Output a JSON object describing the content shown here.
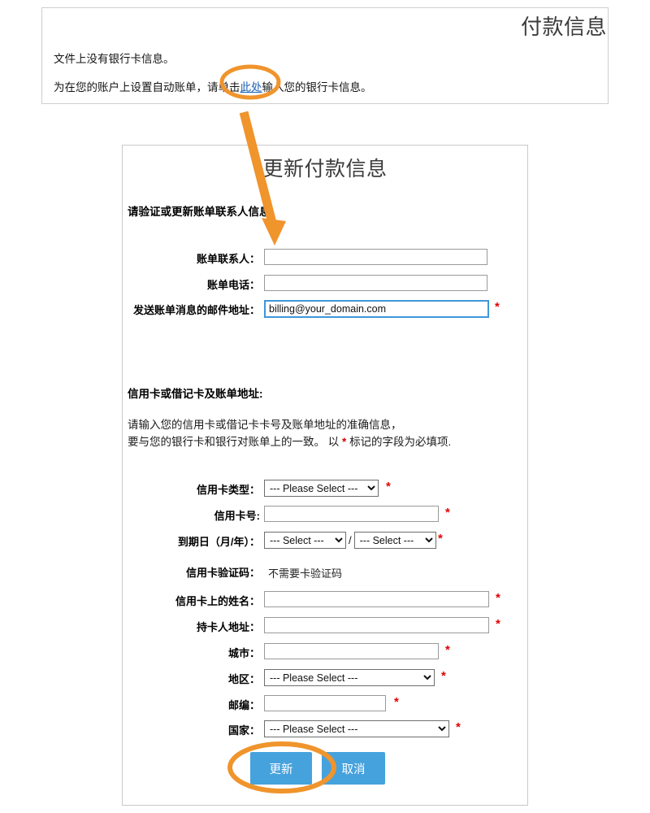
{
  "page": {
    "title": "付款信息"
  },
  "notice": {
    "line1": "文件上没有银行卡信息。",
    "line2_before": "为在您的账户上设置自动账单，请单击",
    "link_text": "此处",
    "line2_after": "输入您的银行卡信息。"
  },
  "form": {
    "title": "更新付款信息",
    "contact_section_heading": "请验证或更新账单联系人信息",
    "card_section_heading": "信用卡或借记卡及账单地址:",
    "intro_line1": "请输入您的信用卡或借记卡卡号及账单地址的准确信息，",
    "intro_line2_a": "要与您的银行卡和银行对账单上的一致。 以",
    "intro_line2_star": "*",
    "intro_line2_b": "标记的字段为必填项.",
    "fields": {
      "billing_contact": {
        "label": "账单联系人：",
        "value": "",
        "required": false
      },
      "billing_phone": {
        "label": "账单电话：",
        "value": "",
        "required": false
      },
      "billing_email": {
        "label": "发送账单消息的邮件地址：",
        "value": "billing@your_domain.com",
        "required": true,
        "focused": true
      },
      "card_type": {
        "label": "信用卡类型：",
        "value": "--- Please Select ---",
        "required": true
      },
      "card_number": {
        "label": "信用卡号:",
        "value": "",
        "required": true
      },
      "expiry": {
        "label": "到期日（月/年）：",
        "month_value": "--- Select ---",
        "year_value": "--- Select ---",
        "separator": "/",
        "required": true
      },
      "cvv": {
        "label": "信用卡验证码：",
        "static_text": "不需要卡验证码",
        "required": false
      },
      "name_on_card": {
        "label": "信用卡上的姓名：",
        "value": "",
        "required": true
      },
      "cardholder_address": {
        "label": "持卡人地址：",
        "value": "",
        "required": true
      },
      "city": {
        "label": "城市：",
        "value": "",
        "required": true
      },
      "region": {
        "label": "地区：",
        "value": "--- Please Select ---",
        "required": true
      },
      "postal_code": {
        "label": "邮编：",
        "value": "",
        "required": true
      },
      "country": {
        "label": "国家：",
        "value": "--- Please Select ---",
        "required": true
      }
    },
    "buttons": {
      "update": "更新",
      "cancel": "取消"
    }
  },
  "annotation": {
    "color": "#f0942c",
    "highlight_link_shape": "ellipse",
    "highlight_button_shape": "ellipse",
    "arrow": "down-right-arrow"
  }
}
